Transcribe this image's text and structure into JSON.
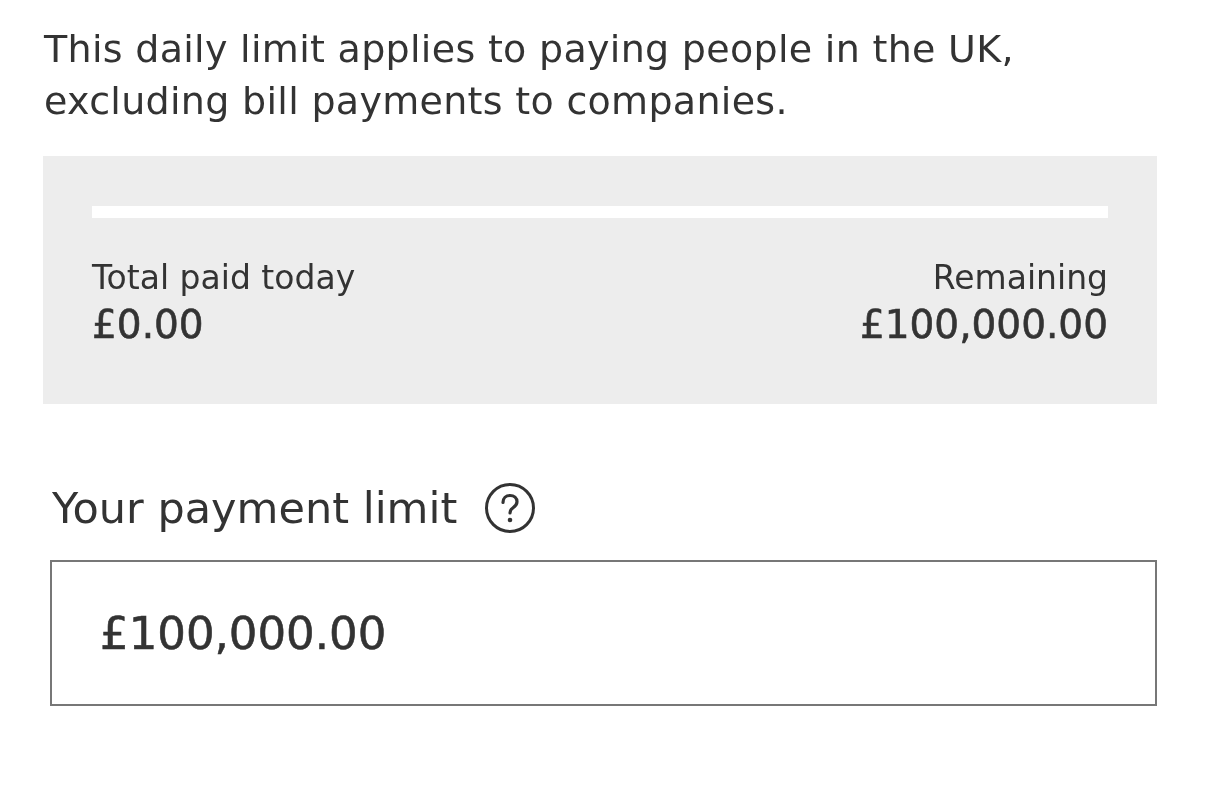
{
  "description": "This daily limit applies to paying people in the UK, excluding bill payments to companies.",
  "summary": {
    "paid": {
      "label": "Total paid today",
      "amount": "£0.00"
    },
    "remaining": {
      "label": "Remaining",
      "amount": "£100,000.00"
    }
  },
  "limit_field": {
    "label": "Your payment limit",
    "value": "£100,000.00"
  }
}
